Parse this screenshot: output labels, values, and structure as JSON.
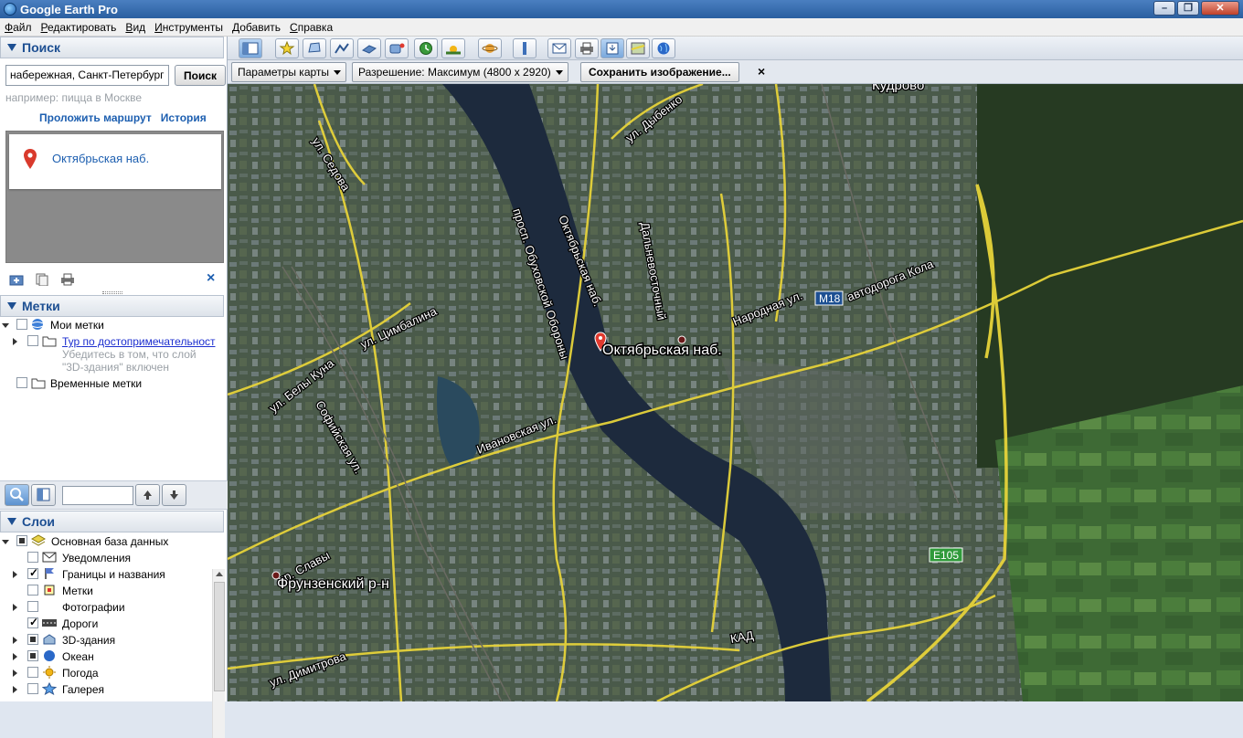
{
  "window": {
    "title": "Google Earth Pro"
  },
  "menu": [
    "Файл",
    "Редактировать",
    "Вид",
    "Инструменты",
    "Добавить",
    "Справка"
  ],
  "search": {
    "header": "Поиск",
    "query": "набережная, Санкт-Петербург",
    "button": "Поиск",
    "hint": "например: пицца в Москве",
    "route_link": "Проложить маршрут",
    "history_link": "История",
    "result": "Октябрьская наб."
  },
  "places": {
    "header": "Метки",
    "items": [
      {
        "label": "Мои метки"
      },
      {
        "label": "Тур по достопримечательност",
        "note1": "Убедитесь в том, что слой",
        "note2": "\"3D-здания\" включен"
      },
      {
        "label": "Временные метки"
      }
    ]
  },
  "layers": {
    "header": "Слои",
    "items": [
      {
        "label": "Основная база данных",
        "checked": "partial"
      },
      {
        "label": "Уведомления",
        "checked": "off"
      },
      {
        "label": "Границы и названия",
        "checked": "on"
      },
      {
        "label": "Метки",
        "checked": "off"
      },
      {
        "label": "Фотографии",
        "checked": "off"
      },
      {
        "label": "Дороги",
        "checked": "on"
      },
      {
        "label": "3D-здания",
        "checked": "partial"
      },
      {
        "label": "Океан",
        "checked": "partial"
      },
      {
        "label": "Погода",
        "checked": "off"
      },
      {
        "label": "Галерея",
        "checked": "off"
      }
    ]
  },
  "imagebar": {
    "map_options": "Параметры карты",
    "resolution": "Разрешение: Максимум (4800 x 2920)",
    "save": "Сохранить изображение...",
    "close": "×"
  },
  "map": {
    "labels": {
      "kudrovo": "Кудрово",
      "dybenko": "ул. Дыбенко",
      "sedova": "ул. Седова",
      "obukhovskoy": "просп. Обуховской Обороны",
      "oktyabrskaya_street": "Октябрьская наб.",
      "dalnevostochny": "Дальневосточный",
      "narodnaya": "Народная ул.",
      "avtodoroga": "автодорога Кола",
      "m18": "M18",
      "tsimbalina": "ул. Цимбалина",
      "bely_kuna": "ул. Белы Куна",
      "sofiyskaya": "Софийская ул.",
      "ivanovskaya": "Ивановская ул.",
      "placemark": "Октябрьская наб.",
      "slavy": "пр. Славы",
      "frunzensky": "Фрунзенский р-н",
      "dimitrova": "ул. Димитрова",
      "kad": "КАД",
      "e105": "E105"
    },
    "accent": {
      "road": "#e6d33a",
      "water": "#1d2a3d",
      "placemark": "#e03a2f"
    }
  }
}
